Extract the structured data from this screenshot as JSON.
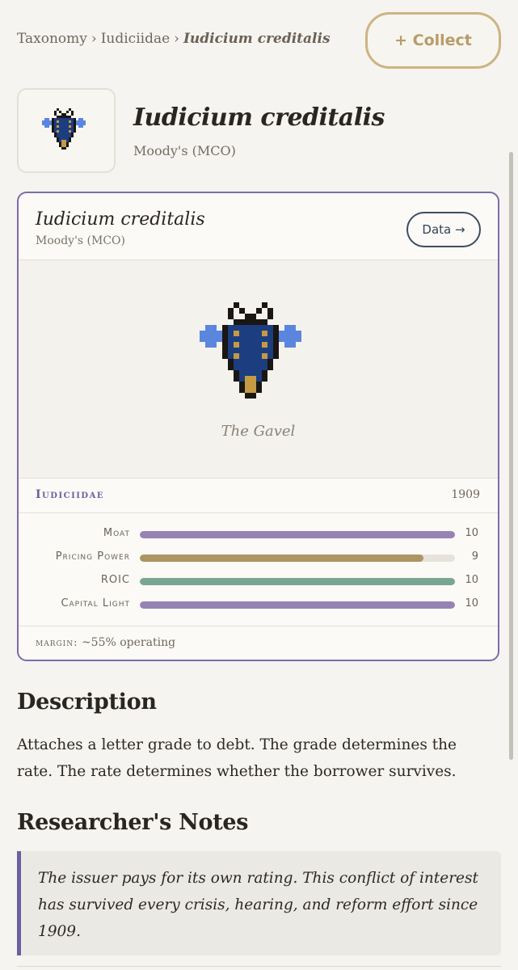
{
  "breadcrumb": {
    "items": [
      "Taxonomy",
      "Iudiciidae"
    ],
    "separator": "›",
    "current": "Iudicium creditalis"
  },
  "collect_button": {
    "label": "+ Collect"
  },
  "header": {
    "title": "Iudicium creditalis",
    "subtitle": "Moody's (MCO)"
  },
  "card": {
    "title": "Iudicium creditalis",
    "subtitle": "Moody's (MCO)",
    "data_button": "Data →",
    "caption": "The Gavel",
    "family": "Iudiciidae",
    "year": "1909",
    "stats": [
      {
        "label": "Moat",
        "value": "10",
        "fraction": 1.0,
        "color": "#9683b4"
      },
      {
        "label": "Pricing Power",
        "value": "9",
        "fraction": 0.9,
        "color": "#ab9563"
      },
      {
        "label": "ROIC",
        "value": "10",
        "fraction": 1.0,
        "color": "#7aa592"
      },
      {
        "label": "Capital Light",
        "value": "10",
        "fraction": 1.0,
        "color": "#9683b4"
      }
    ],
    "margin_label": "margin:",
    "margin_value": "~55% operating"
  },
  "description": {
    "heading": "Description",
    "text": "Attaches a letter grade to debt. The grade determines the rate. The rate determines whether the borrower survives."
  },
  "notes": {
    "heading": "Researcher's Notes",
    "text": "The issuer pays for its own rating. This conflict of interest has survived every crisis, hearing, and reform effort since 1909."
  },
  "colors": {
    "accent": "#6d5fa0",
    "card_border": "#7e6ba8",
    "collect_border": "#cdb483",
    "beetle_body": "#1c3d80",
    "beetle_wing": "#5b86de",
    "beetle_outline": "#1a1612",
    "beetle_gold": "#c49a45"
  },
  "icons": {
    "thumbnail": "beetle-sprite-icon",
    "art": "beetle-sprite-icon"
  }
}
